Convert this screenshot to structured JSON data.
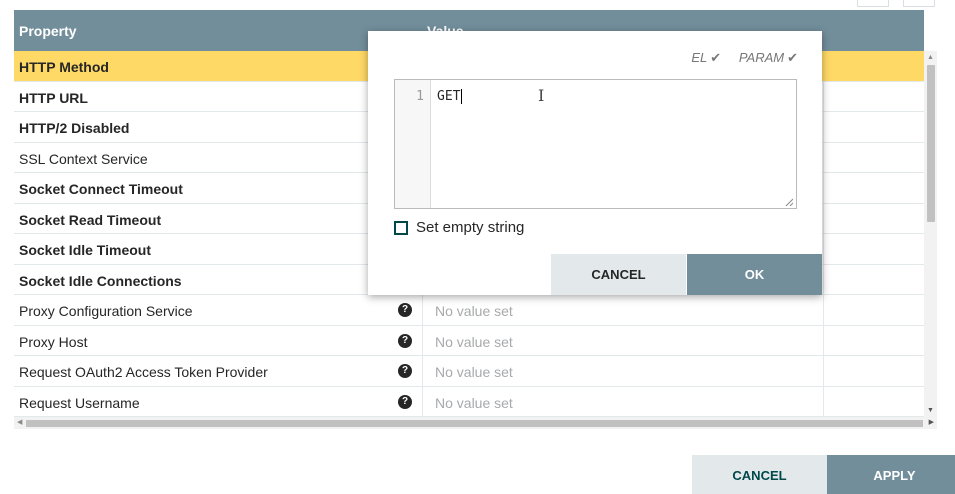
{
  "table": {
    "headers": {
      "property": "Property",
      "value": "Value"
    },
    "rows": [
      {
        "name": "HTTP Method",
        "bold": true,
        "selected": true,
        "help": false,
        "value": ""
      },
      {
        "name": "HTTP URL",
        "bold": true,
        "selected": false,
        "help": false,
        "value": ""
      },
      {
        "name": "HTTP/2 Disabled",
        "bold": true,
        "selected": false,
        "help": false,
        "value": ""
      },
      {
        "name": "SSL Context Service",
        "bold": false,
        "selected": false,
        "help": false,
        "value": ""
      },
      {
        "name": "Socket Connect Timeout",
        "bold": true,
        "selected": false,
        "help": false,
        "value": ""
      },
      {
        "name": "Socket Read Timeout",
        "bold": true,
        "selected": false,
        "help": false,
        "value": ""
      },
      {
        "name": "Socket Idle Timeout",
        "bold": true,
        "selected": false,
        "help": false,
        "value": ""
      },
      {
        "name": "Socket Idle Connections",
        "bold": true,
        "selected": false,
        "help": false,
        "value": ""
      },
      {
        "name": "Proxy Configuration Service",
        "bold": false,
        "selected": false,
        "help": true,
        "value": "No value set"
      },
      {
        "name": "Proxy Host",
        "bold": false,
        "selected": false,
        "help": true,
        "value": "No value set"
      },
      {
        "name": "Request OAuth2 Access Token Provider",
        "bold": false,
        "selected": false,
        "help": true,
        "value": "No value set"
      },
      {
        "name": "Request Username",
        "bold": false,
        "selected": false,
        "help": true,
        "value": "No value set"
      }
    ],
    "help_glyph": "?"
  },
  "dialog": {
    "flags": [
      {
        "label": "EL"
      },
      {
        "label": "PARAM"
      }
    ],
    "check_glyph": "✔",
    "editor": {
      "line_number": "1",
      "text": "GET"
    },
    "empty_string_label": "Set empty string",
    "cancel_label": "CANCEL",
    "ok_label": "OK"
  },
  "footer": {
    "cancel_label": "CANCEL",
    "apply_label": "APPLY"
  },
  "colors": {
    "header": "#728e9b",
    "selected_row": "#ffd966",
    "secondary_button": "#e3e8eb",
    "primary_button": "#728e9b"
  }
}
